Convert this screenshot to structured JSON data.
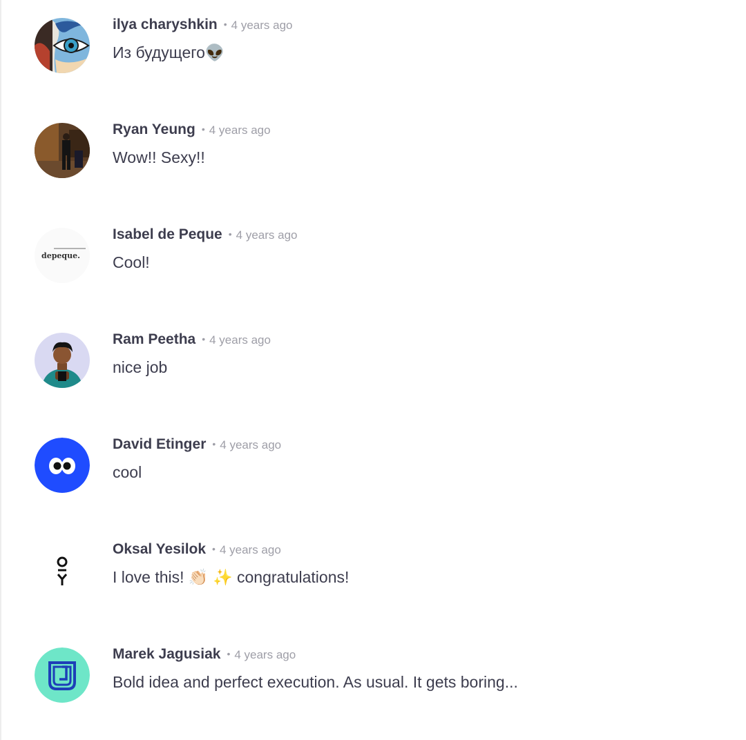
{
  "comments": [
    {
      "author": "ilya charyshkin",
      "time": "4 years ago",
      "text": "Из будущего👽",
      "avatar_icon": "ilya-eye-art-avatar"
    },
    {
      "author": "Ryan Yeung",
      "time": "4 years ago",
      "text": "Wow!! Sexy!!",
      "avatar_icon": "ryan-photo-avatar"
    },
    {
      "author": "Isabel de Peque",
      "time": "4 years ago",
      "text": "Cool!",
      "avatar_icon": "depeque-logo-avatar",
      "avatar_logo_text": "depeque."
    },
    {
      "author": "Ram Peetha",
      "time": "4 years ago",
      "text": "nice job",
      "avatar_icon": "ram-photo-avatar"
    },
    {
      "author": "David Etinger",
      "time": "4 years ago",
      "text": "cool",
      "avatar_icon": "googly-eyes-avatar"
    },
    {
      "author": "Oksal Yesilok",
      "time": "4 years ago",
      "text": "I love this! 👏🏻 ✨  congratulations!",
      "avatar_icon": "oy-logo-avatar"
    },
    {
      "author": "Marek Jagusiak",
      "time": "4 years ago",
      "text": "Bold idea and perfect execution. As usual. It gets boring...",
      "avatar_icon": "j-monogram-avatar"
    }
  ],
  "colors": {
    "author": "#3d3d4e",
    "meta": "#9e9ea7",
    "david_avatar_bg": "#1f4cff",
    "marek_avatar_bg": "#6ee6c8",
    "marek_monogram": "#1d3fb8"
  }
}
